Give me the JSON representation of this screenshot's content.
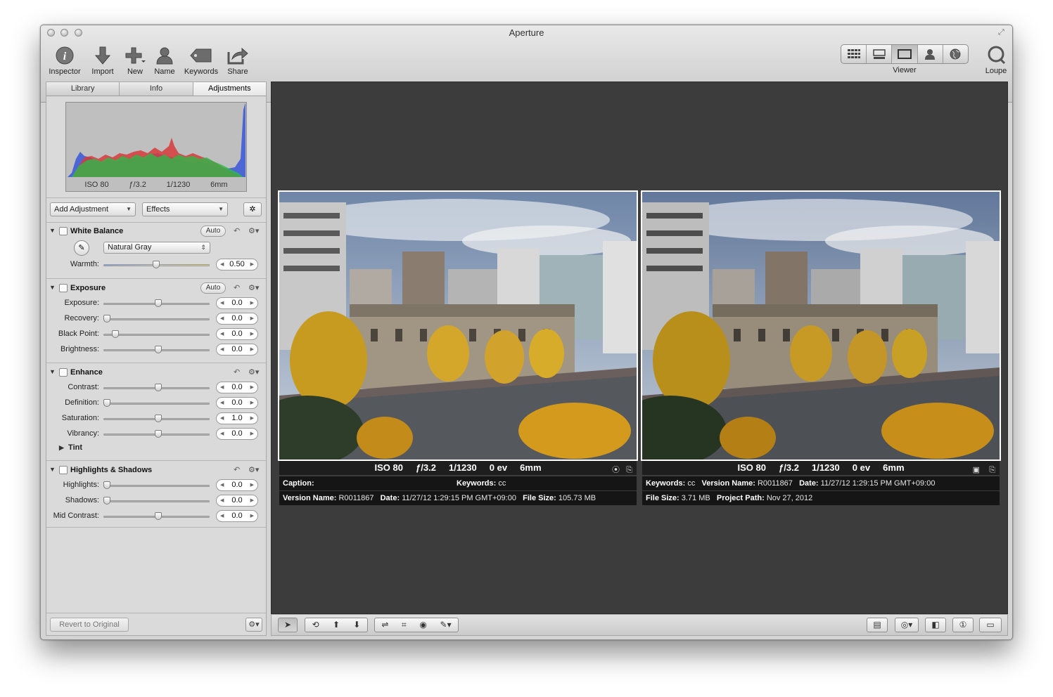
{
  "window": {
    "title": "Aperture"
  },
  "toolbar": {
    "inspector": "Inspector",
    "import": "Import",
    "new": "New",
    "name": "Name",
    "keywords": "Keywords",
    "share": "Share",
    "viewer": "Viewer",
    "loupe": "Loupe"
  },
  "inspector_tabs": [
    "Library",
    "Info",
    "Adjustments"
  ],
  "histogram": {
    "iso": "ISO 80",
    "aperture": "ƒ/3.2",
    "shutter": "1/1230",
    "focal": "6mm"
  },
  "adjust_menus": {
    "add": "Add Adjustment",
    "effects": "Effects"
  },
  "white_balance": {
    "title": "White Balance",
    "auto": "Auto",
    "mode": "Natural Gray",
    "warmth_label": "Warmth:",
    "warmth_value": "0.50"
  },
  "exposure": {
    "title": "Exposure",
    "auto": "Auto",
    "rows": [
      {
        "label": "Exposure:",
        "value": "0.0",
        "pos": 0.5
      },
      {
        "label": "Recovery:",
        "value": "0.0",
        "pos": 0.0
      },
      {
        "label": "Black Point:",
        "value": "0.0",
        "pos": 0.08
      },
      {
        "label": "Brightness:",
        "value": "0.0",
        "pos": 0.5
      }
    ]
  },
  "enhance": {
    "title": "Enhance",
    "rows": [
      {
        "label": "Contrast:",
        "value": "0.0",
        "pos": 0.5
      },
      {
        "label": "Definition:",
        "value": "0.0",
        "pos": 0.0
      },
      {
        "label": "Saturation:",
        "value": "1.0",
        "pos": 0.5
      },
      {
        "label": "Vibrancy:",
        "value": "0.0",
        "pos": 0.5
      }
    ],
    "tint": "Tint"
  },
  "highlights_shadows": {
    "title": "Highlights & Shadows",
    "rows": [
      {
        "label": "Highlights:",
        "value": "0.0",
        "pos": 0.0
      },
      {
        "label": "Shadows:",
        "value": "0.0",
        "pos": 0.0
      },
      {
        "label": "Mid Contrast:",
        "value": "0.0",
        "pos": 0.5
      }
    ]
  },
  "footer": {
    "revert": "Revert to Original"
  },
  "photo_left": {
    "exif": "ISO 80     ƒ/3.2     1/1230     0 ev     6mm",
    "row1": {
      "caption_label": "Caption:",
      "caption_value": "",
      "keywords_label": "Keywords:",
      "keywords_value": "cc"
    },
    "row2": {
      "version_label": "Version Name:",
      "version_value": "R0011867",
      "date_label": "Date:",
      "date_value": "11/27/12 1:29:15 PM GMT+09:00",
      "size_label": "File Size:",
      "size_value": "105.73 MB"
    }
  },
  "photo_right": {
    "exif": "ISO 80     ƒ/3.2     1/1230     0 ev     6mm",
    "row1": {
      "keywords_label": "Keywords:",
      "keywords_value": "cc",
      "version_label": "Version Name:",
      "version_value": "R0011867",
      "date_label": "Date:",
      "date_value": "11/27/12 1:29:15 PM GMT+09:00"
    },
    "row2": {
      "size_label": "File Size:",
      "size_value": "3.71 MB",
      "path_label": "Project Path:",
      "path_value": "Nov 27, 2012"
    }
  }
}
